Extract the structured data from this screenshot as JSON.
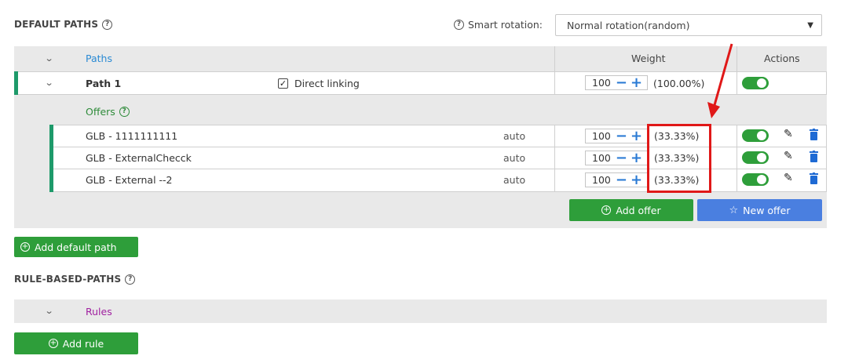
{
  "default_paths": {
    "title": "DEFAULT PATHS",
    "smart_rotation_label": "Smart rotation:",
    "rotation_select_value": "Normal rotation(random)",
    "header": {
      "paths": "Paths",
      "weight": "Weight",
      "actions": "Actions"
    },
    "path": {
      "name": "Path 1",
      "direct_linking_label": "Direct linking",
      "weight": "100",
      "percent": "(100.00%)"
    },
    "offers_label": "Offers",
    "offers": [
      {
        "name": "GLB - 1111111111",
        "mode": "auto",
        "weight": "100",
        "percent": "(33.33%)"
      },
      {
        "name": "GLB - ExternalChecck",
        "mode": "auto",
        "weight": "100",
        "percent": "(33.33%)"
      },
      {
        "name": "GLB - External --2",
        "mode": "auto",
        "weight": "100",
        "percent": "(33.33%)"
      }
    ],
    "add_offer_label": "Add offer",
    "new_offer_label": "New offer",
    "add_default_path_label": "Add default path"
  },
  "rule_based_paths": {
    "title": "RULE-BASED-PATHS",
    "rules_label": "Rules",
    "add_rule_label": "Add rule"
  },
  "colors": {
    "accent_green": "#2e9e3a",
    "accent_blue": "#4a7fe0",
    "annotation_red": "#e01818"
  }
}
